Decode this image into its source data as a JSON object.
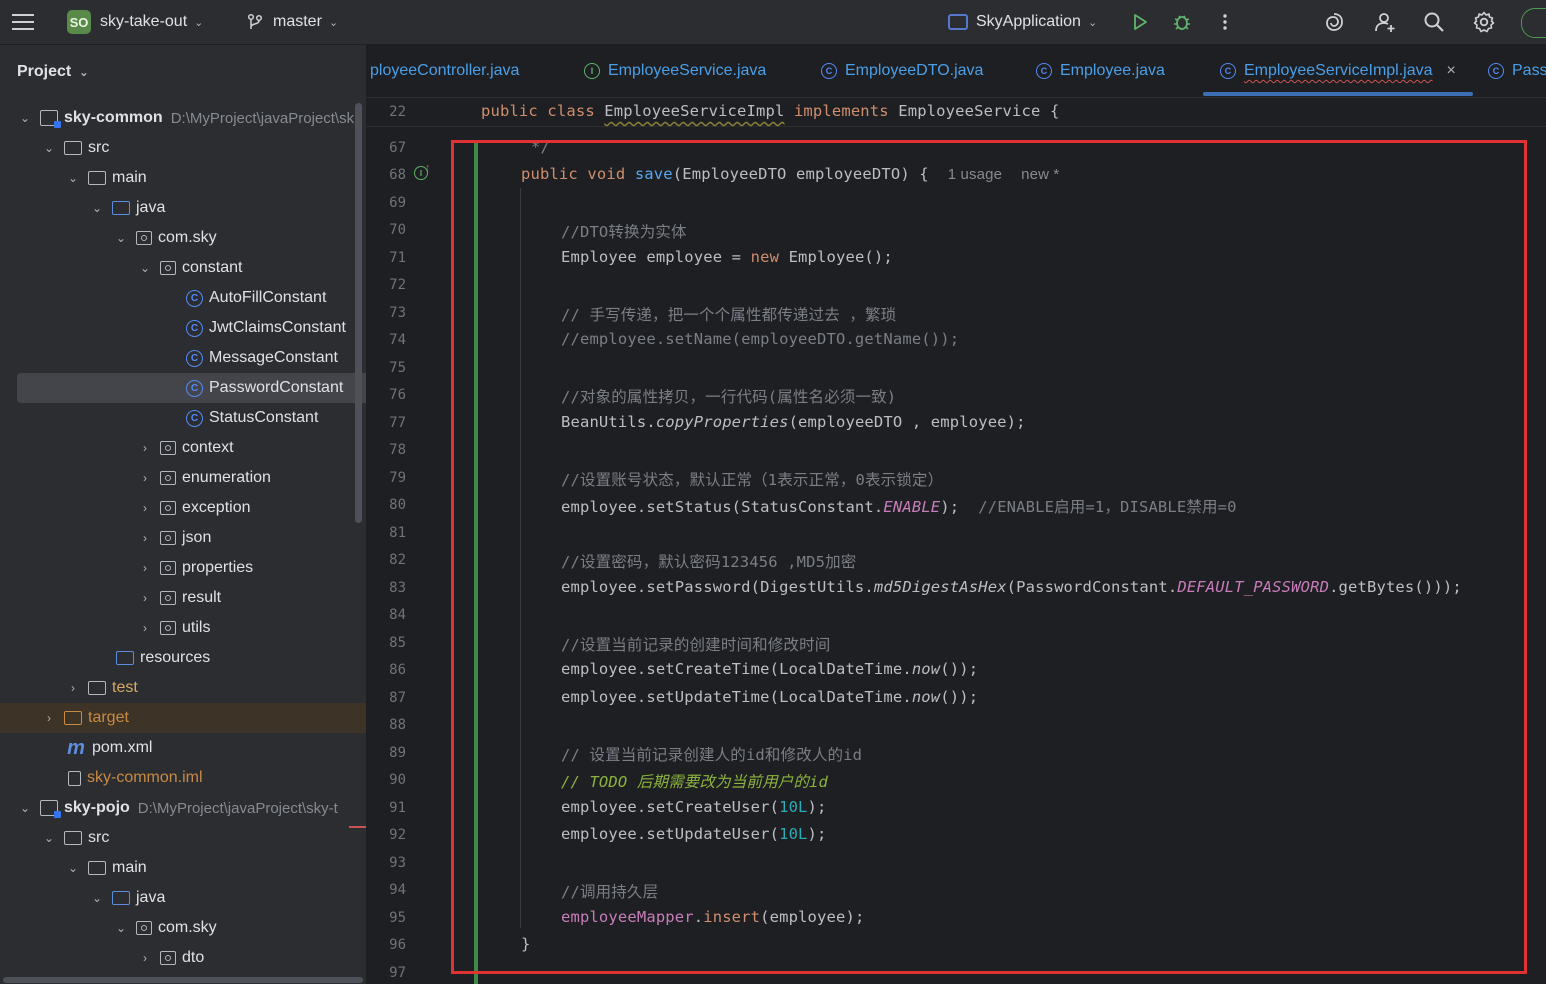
{
  "topbar": {
    "project_badge": "SO",
    "project_name": "sky-take-out",
    "branch": "master",
    "run_config": "SkyApplication"
  },
  "project_panel": {
    "title": "Project",
    "rows": [
      {
        "label": "sky-common",
        "extra": "D:\\MyProject\\javaProject\\sk"
      },
      {
        "label": "src"
      },
      {
        "label": "main"
      },
      {
        "label": "java"
      },
      {
        "label": "com.sky"
      },
      {
        "label": "constant"
      },
      {
        "label": "AutoFillConstant"
      },
      {
        "label": "JwtClaimsConstant"
      },
      {
        "label": "MessageConstant"
      },
      {
        "label": "PasswordConstant"
      },
      {
        "label": "StatusConstant"
      },
      {
        "label": "context"
      },
      {
        "label": "enumeration"
      },
      {
        "label": "exception"
      },
      {
        "label": "json"
      },
      {
        "label": "properties"
      },
      {
        "label": "result"
      },
      {
        "label": "utils"
      },
      {
        "label": "resources"
      },
      {
        "label": "test"
      },
      {
        "label": "target"
      },
      {
        "label": "pom.xml"
      },
      {
        "label": "sky-common.iml"
      },
      {
        "label": "sky-pojo",
        "extra": "D:\\MyProject\\javaProject\\sky-t"
      },
      {
        "label": "src"
      },
      {
        "label": "main"
      },
      {
        "label": "java"
      },
      {
        "label": "com.sky"
      },
      {
        "label": "dto"
      }
    ]
  },
  "tabs": [
    {
      "label": "ployeeController.java",
      "icon": "class-icon"
    },
    {
      "label": "EmployeeService.java",
      "icon": "interface-icon"
    },
    {
      "label": "EmployeeDTO.java",
      "icon": "class-icon"
    },
    {
      "label": "Employee.java",
      "icon": "class-icon"
    },
    {
      "label": "EmployeeServiceImpl.java",
      "icon": "class-icon"
    },
    {
      "label": "Pass",
      "icon": "class-icon"
    }
  ],
  "editor": {
    "sticky_line_number": "22",
    "sticky_line": {
      "kw1": "public",
      "kw2": "class",
      "name": "EmployeeServiceImpl",
      "kw3": "implements",
      "rest": "EmployeeService {"
    },
    "line_numbers": [
      "67",
      "68",
      "69",
      "70",
      "71",
      "72",
      "73",
      "74",
      "75",
      "76",
      "77",
      "78",
      "79",
      "80",
      "81",
      "82",
      "83",
      "84",
      "85",
      "86",
      "87",
      "88",
      "89",
      "90",
      "91",
      "92",
      "93",
      "94",
      "95",
      "96",
      "97"
    ],
    "hint_usage": "1 usage",
    "hint_new": "new *",
    "lines": {
      "l67": "*/",
      "l68a": "public",
      "l68b": "void",
      "l68c": "save",
      "l68d": "(EmployeeDTO employeeDTO) {",
      "l70": "//DTO转换为实体",
      "l71a": "Employee employee = ",
      "l71b": "new",
      "l71c": " Employee();",
      "l73": "// 手写传递，把一个个属性都传递过去 ，繁琐",
      "l74": "//employee.setName(employeeDTO.getName());",
      "l76": "//对象的属性拷贝，一行代码(属性名必须一致)",
      "l77a": "BeanUtils.",
      "l77b": "copyProperties",
      "l77c": "(employeeDTO , employee);",
      "l79": "//设置账号状态，默认正常（1表示正常，0表示锁定）",
      "l80a": "employee.setStatus(StatusConstant.",
      "l80b": "ENABLE",
      "l80c": ");  ",
      "l80d": "//ENABLE启用=1，DISABLE禁用=0",
      "l82": "//设置密码，默认密码123456 ,MD5加密",
      "l83a": "employee.setPassword(DigestUtils.",
      "l83b": "md5DigestAsHex",
      "l83c": "(PasswordConstant.",
      "l83d": "DEFAULT_PASSWORD",
      "l83e": ".getBytes()));",
      "l85": "//设置当前记录的创建时间和修改时间",
      "l86a": "employee.setCreateTime(LocalDateTime.",
      "l86b": "now",
      "l86c": "());",
      "l87a": "employee.setUpdateTime(LocalDateTime.",
      "l87b": "now",
      "l87c": "());",
      "l89": "// 设置当前记录创建人的id和修改人的id",
      "l90a": "// ",
      "l90b": "TODO 后期需要改为当前用户的id",
      "l91a": "employee.setCreateUser(",
      "l91b": "10L",
      "l91c": ");",
      "l92a": "employee.setUpdateUser(",
      "l92b": "10L",
      "l92c": ");",
      "l94": "//调用持久层",
      "l95a": "employeeMapper",
      "l95b": ".",
      "l95c": "insert",
      "l95d": "(employee);",
      "l96": "}"
    }
  },
  "colors": {
    "accent": "#3574f0",
    "highlight_box": "#e03232",
    "change_bar": "#3e8a4a"
  }
}
